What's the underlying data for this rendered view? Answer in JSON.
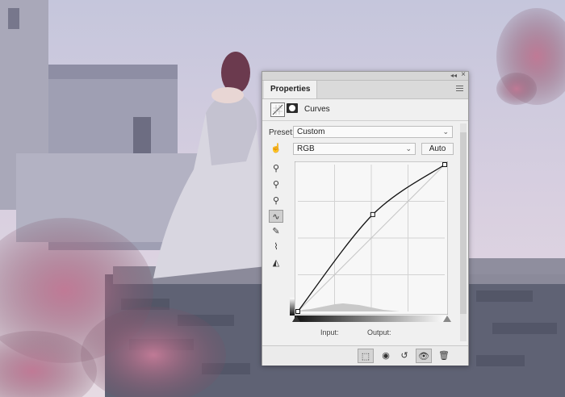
{
  "panel": {
    "tab_label": "Properties",
    "title": "Curves",
    "preset_label": "Preset:",
    "preset_value": "Custom",
    "channel_value": "RGB",
    "auto_label": "Auto",
    "input_label": "Input:",
    "output_label": "Output:"
  },
  "toolbar": [
    "on-image-adjust-icon",
    "eyedropper-black-icon",
    "eyedropper-gray-icon",
    "eyedropper-white-icon",
    "curve-point-icon",
    "pencil-draw-icon",
    "smooth-curve-icon",
    "clipping-warning-icon"
  ],
  "bottom_bar": [
    "clip-to-layer-icon",
    "view-previous-icon",
    "reset-icon",
    "visibility-eye-icon",
    "trash-icon"
  ],
  "colors": {
    "panel_bg": "#f0f0f0",
    "accent": "#d0d0d0"
  },
  "chart_data": {
    "type": "line",
    "series": [
      {
        "name": "",
        "x": [
          0,
          0.51,
          1
        ],
        "y": [
          0,
          0.66,
          1
        ]
      }
    ],
    "xlim": [
      0,
      1
    ],
    "ylim": [
      0,
      1
    ],
    "grid": true
  }
}
